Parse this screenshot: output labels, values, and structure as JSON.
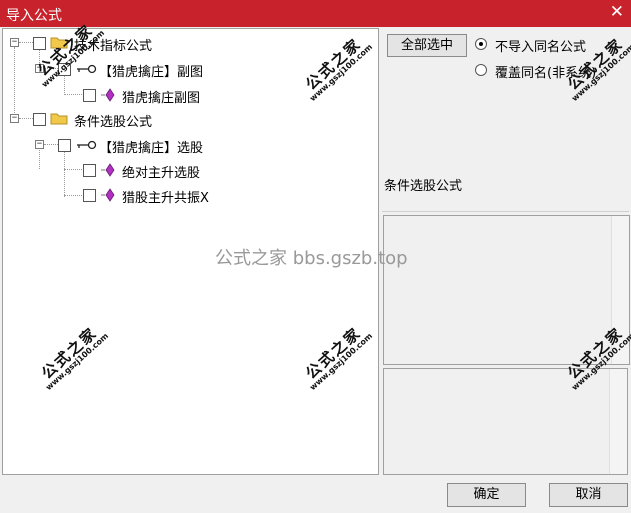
{
  "window": {
    "title": "导入公式",
    "close_glyph": "✕"
  },
  "tree": {
    "nodes": [
      {
        "label": "技术指标公式",
        "expander": "−"
      },
      {
        "label": "【猎虎擒庄】副图",
        "expander": "−"
      },
      {
        "label": "猎虎擒庄副图"
      },
      {
        "label": "条件选股公式",
        "expander": "−"
      },
      {
        "label": "【猎虎擒庄】选股",
        "expander": "−"
      },
      {
        "label": "绝对主升选股"
      },
      {
        "label": "猎股主升共振X"
      }
    ]
  },
  "right": {
    "select_all": "全部选中",
    "options": [
      {
        "label": "不导入同名公式",
        "selected": true
      },
      {
        "label": "覆盖同名(非系统)",
        "selected": false
      }
    ],
    "selected_label": "条件选股公式"
  },
  "footer": {
    "ok": "确定",
    "cancel": "取消"
  },
  "watermarks": {
    "stamp_cn": "公式之家",
    "stamp_url": "www.gszj100.com",
    "center": "公式之家 bbs.gszb.top"
  },
  "colors": {
    "titlebar": "#c8232c",
    "folder": "#f0c94a",
    "gem": "#b030c0"
  }
}
